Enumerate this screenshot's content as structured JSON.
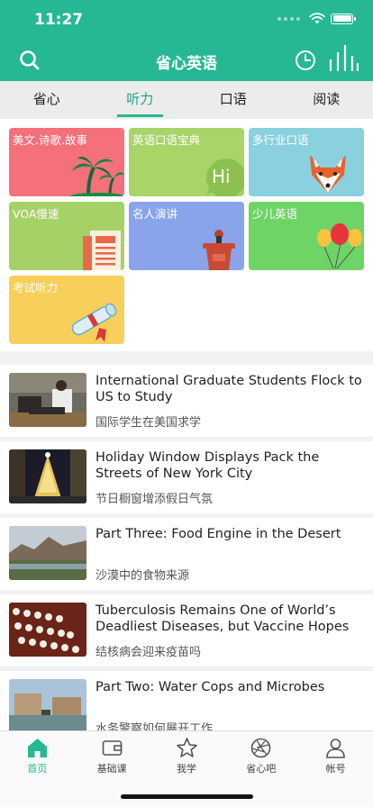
{
  "status": {
    "time": "11:27"
  },
  "header": {
    "title": "省心英语"
  },
  "tabs": [
    {
      "label": "省心"
    },
    {
      "label": "听力"
    },
    {
      "label": "口语"
    },
    {
      "label": "阅读"
    }
  ],
  "active_tab": "听力",
  "categories": [
    {
      "label": "美文.诗歌.故事",
      "color": "#f4707a",
      "icon": "palm-trees-icon"
    },
    {
      "label": "英语口语宝典",
      "color": "#a8d468",
      "icon": "hi-bubble-icon",
      "badge": "Hi"
    },
    {
      "label": "多行业口语",
      "color": "#8ad0de",
      "icon": "fox-icon"
    },
    {
      "label": "VOA慢速",
      "color": "#a6d166",
      "icon": "newspaper-icon"
    },
    {
      "label": "名人演讲",
      "color": "#8aa4ec",
      "icon": "podium-icon"
    },
    {
      "label": "少儿英语",
      "color": "#6fd466",
      "icon": "balloons-icon"
    },
    {
      "label": "考试听力",
      "color": "#f8cf5a",
      "icon": "diploma-icon"
    }
  ],
  "news": [
    {
      "title": "International Graduate Students Flock to US to Study",
      "subtitle": "国际学生在美国求学"
    },
    {
      "title": "Holiday Window Displays Pack the Streets of New York City",
      "subtitle": "节日橱窗增添假日气氛"
    },
    {
      "title": "Part Three: Food Engine in the Desert",
      "subtitle": "沙漠中的食物来源"
    },
    {
      "title": "Tuberculosis Remains One of World’s Deadliest Diseases, but Vaccine Hopes Rise",
      "subtitle": "结核病会迎来疫苗吗"
    },
    {
      "title": "Part Two: Water Cops and Microbes",
      "subtitle": "水务警察如何展开工作"
    }
  ],
  "tabbar": [
    {
      "label": "首页",
      "icon": "home-icon"
    },
    {
      "label": "基础课",
      "icon": "wallet-icon"
    },
    {
      "label": "我学",
      "icon": "star-icon"
    },
    {
      "label": "省心吧",
      "icon": "aperture-icon"
    },
    {
      "label": "帐号",
      "icon": "user-icon"
    }
  ],
  "active_tabbar": "首页",
  "colors": {
    "brand": "#26b894",
    "tab_active": "#1aa385"
  }
}
